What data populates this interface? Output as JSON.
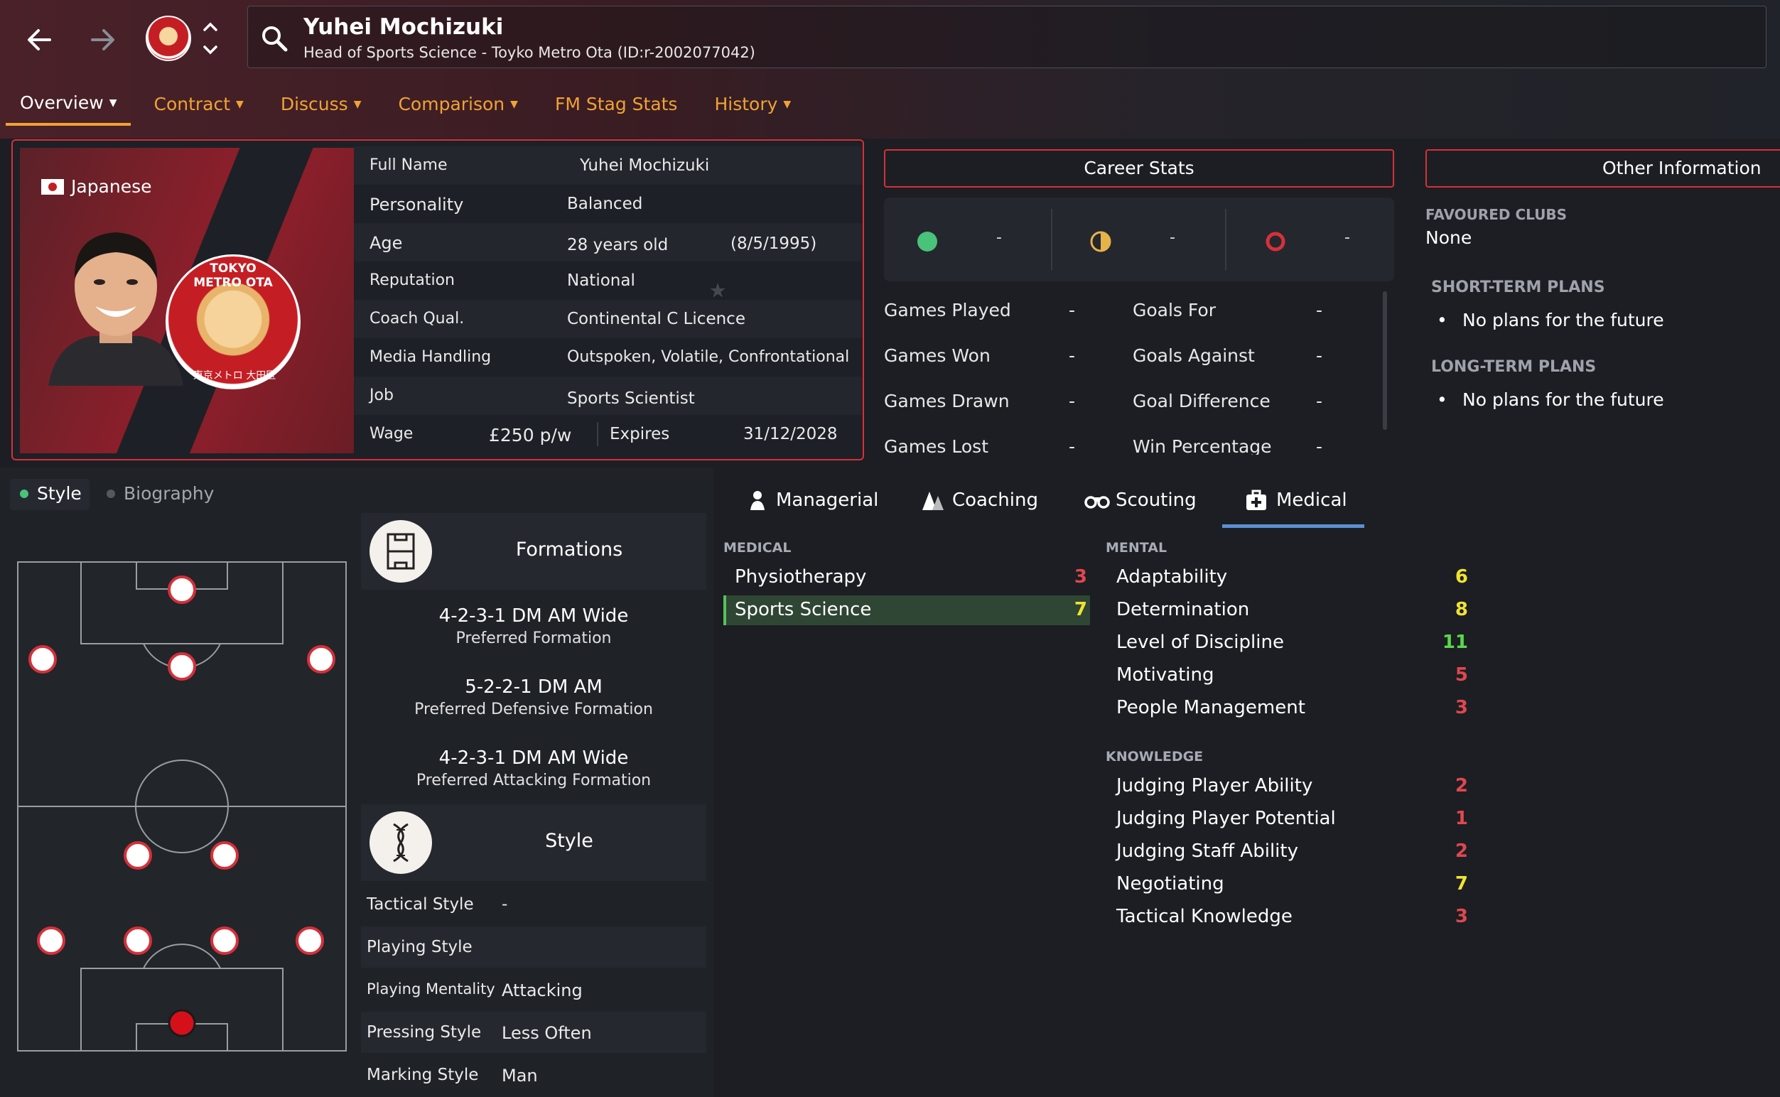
{
  "header": {
    "name": "Yuhei Mochizuki",
    "subtitle": "Head of Sports Science - Toyko Metro Ota (ID:r-2002077042)"
  },
  "tabs": [
    {
      "label": "Overview",
      "dropdown": true
    },
    {
      "label": "Contract",
      "dropdown": true
    },
    {
      "label": "Discuss",
      "dropdown": true
    },
    {
      "label": "Comparison",
      "dropdown": true
    },
    {
      "label": "FM Stag Stats",
      "dropdown": false
    },
    {
      "label": "History",
      "dropdown": true
    }
  ],
  "profile": {
    "nationality": "Japanese",
    "crest_text": "TOKYO METRO OTA",
    "crest_text_jp": "東京メトロ 大田区",
    "full_name_label": "Full Name",
    "full_name": "Yuhei Mochizuki",
    "personality_label": "Personality",
    "personality": "Balanced",
    "age_label": "Age",
    "age": "28 years old",
    "dob": "(8/5/1995)",
    "reputation_label": "Reputation",
    "reputation": "National",
    "reputation_stars": 1,
    "reputation_stars_max": 5,
    "coach_qual_label": "Coach Qual.",
    "coach_qual": "Continental C Licence",
    "media_label": "Media Handling",
    "media": "Outspoken, Volatile, Confrontational",
    "job_label": "Job",
    "job": "Sports Scientist",
    "wage_label": "Wage",
    "wage": "£250 p/w",
    "expires_label": "Expires",
    "expires": "31/12/2028"
  },
  "career": {
    "header": "Career Stats",
    "wins": "-",
    "draws": "-",
    "losses": "-",
    "rows": [
      {
        "l1": "Games Played",
        "v1": "-",
        "l2": "Goals For",
        "v2": "-"
      },
      {
        "l1": "Games Won",
        "v1": "-",
        "l2": "Goals Against",
        "v2": "-"
      },
      {
        "l1": "Games Drawn",
        "v1": "-",
        "l2": "Goal Difference",
        "v2": "-"
      },
      {
        "l1": "Games Lost",
        "v1": "-",
        "l2": "Win Percentage",
        "v2": "-"
      }
    ],
    "colors": {
      "win": "#49c27a",
      "draw": "#e7b24a",
      "loss": "#d6303a"
    }
  },
  "other": {
    "header": "Other Information",
    "favoured_label": "FAVOURED CLUBS",
    "favoured": "None",
    "short_label": "SHORT-TERM PLANS",
    "short": "No plans for the future",
    "long_label": "LONG-TERM PLANS",
    "long": "No plans for the future"
  },
  "style_panel": {
    "subtab_style": "Style",
    "subtab_bio": "Biography",
    "formations_title": "Formations",
    "formations": [
      {
        "name": "4-2-3-1 DM AM Wide",
        "desc": "Preferred Formation"
      },
      {
        "name": "5-2-2-1 DM AM",
        "desc": "Preferred Defensive Formation"
      },
      {
        "name": "4-2-3-1 DM AM Wide",
        "desc": "Preferred Attacking Formation"
      }
    ],
    "style_title": "Style",
    "rows": [
      {
        "label": "Tactical Style",
        "value": "-"
      },
      {
        "label": "Playing Style",
        "value": ""
      },
      {
        "label": "Playing Mentality",
        "value": "Attacking"
      },
      {
        "label": "Pressing Style",
        "value": "Less Often"
      },
      {
        "label": "Marking Style",
        "value": "Man"
      }
    ]
  },
  "attributes": {
    "tabs": [
      "Managerial",
      "Coaching",
      "Scouting",
      "Medical"
    ],
    "active_tab": "Medical",
    "medical_label": "MEDICAL",
    "medical": [
      {
        "name": "Physiotherapy",
        "value": "3"
      },
      {
        "name": "Sports Science",
        "value": "7"
      }
    ],
    "mental_label": "MENTAL",
    "mental": [
      {
        "name": "Adaptability",
        "value": "6"
      },
      {
        "name": "Determination",
        "value": "8"
      },
      {
        "name": "Level of Discipline",
        "value": "11"
      },
      {
        "name": "Motivating",
        "value": "5"
      },
      {
        "name": "People Management",
        "value": "3"
      }
    ],
    "knowledge_label": "KNOWLEDGE",
    "knowledge": [
      {
        "name": "Judging Player Ability",
        "value": "2"
      },
      {
        "name": "Judging Player Potential",
        "value": "1"
      },
      {
        "name": "Judging Staff Ability",
        "value": "2"
      },
      {
        "name": "Negotiating",
        "value": "7"
      },
      {
        "name": "Tactical Knowledge",
        "value": "3"
      }
    ],
    "value_colors": {
      "low": "#e0474f",
      "mid": "#f2e330",
      "high": "#59d84a"
    }
  },
  "colors": {
    "accent": "#f0a334",
    "highlight": "#d6303a",
    "tab_underline": "#5b8fd6"
  }
}
